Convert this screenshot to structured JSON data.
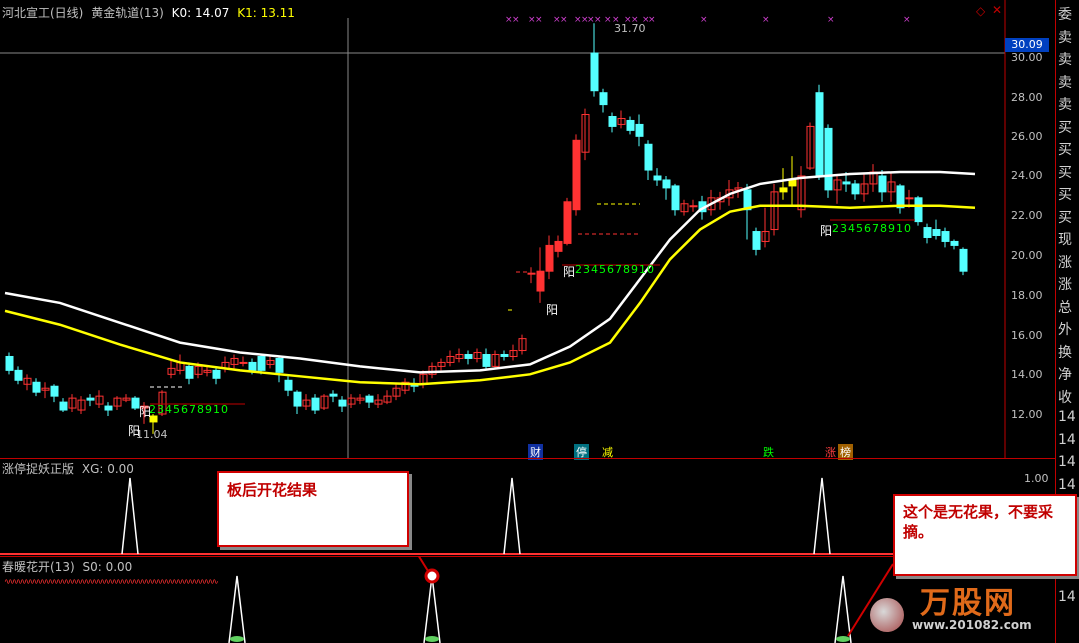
{
  "header": {
    "title": "河北宣工(日线)",
    "indicator": "黄金轨道(13)",
    "k0": "K0: 14.07",
    "k1": "K1: 13.11"
  },
  "price_axis": {
    "current": "30.09",
    "labels": [
      "30.00",
      "28.00",
      "26.00",
      "24.00",
      "22.00",
      "20.00",
      "18.00",
      "16.00",
      "14.00",
      "12.00"
    ]
  },
  "annotations": {
    "high": "31.70",
    "low": "11.04",
    "yang1": "阳",
    "yang2": "阳",
    "yang3": "阳",
    "yang4": "阳",
    "seq1": "2345678910",
    "seq2": "2345678910",
    "seq3": "2345678910"
  },
  "tags": {
    "cai": "财",
    "ting": "停",
    "jian": "减",
    "die": "跌",
    "zhang": "涨",
    "bang": "榜"
  },
  "panel1": {
    "title": "涨停捉妖正版",
    "value": "XG: 0.00",
    "axis": "1.00"
  },
  "panel2": {
    "title": "春暖花开(13)",
    "value": "S0: 0.00"
  },
  "side_panel": {
    "chars": [
      "委",
      "卖",
      "卖",
      "卖",
      "卖",
      "买",
      "买",
      "买",
      "买",
      "买",
      "现",
      "涨",
      "涨",
      "总",
      "外",
      "换",
      "净",
      "收",
      "14",
      "14",
      "14",
      "14",
      "14",
      "14",
      "14",
      "14",
      "14"
    ]
  },
  "callouts": {
    "left": "板后开花结果",
    "right": "这个是无花果，不要采摘。"
  },
  "watermark": {
    "brand": "万股网",
    "url": "www.201082.com"
  },
  "colors": {
    "up": "#ff3232",
    "down": "#54ffff",
    "white_line": "#ffffff",
    "yellow_line": "#ffff00",
    "axis": "#c00000"
  }
}
